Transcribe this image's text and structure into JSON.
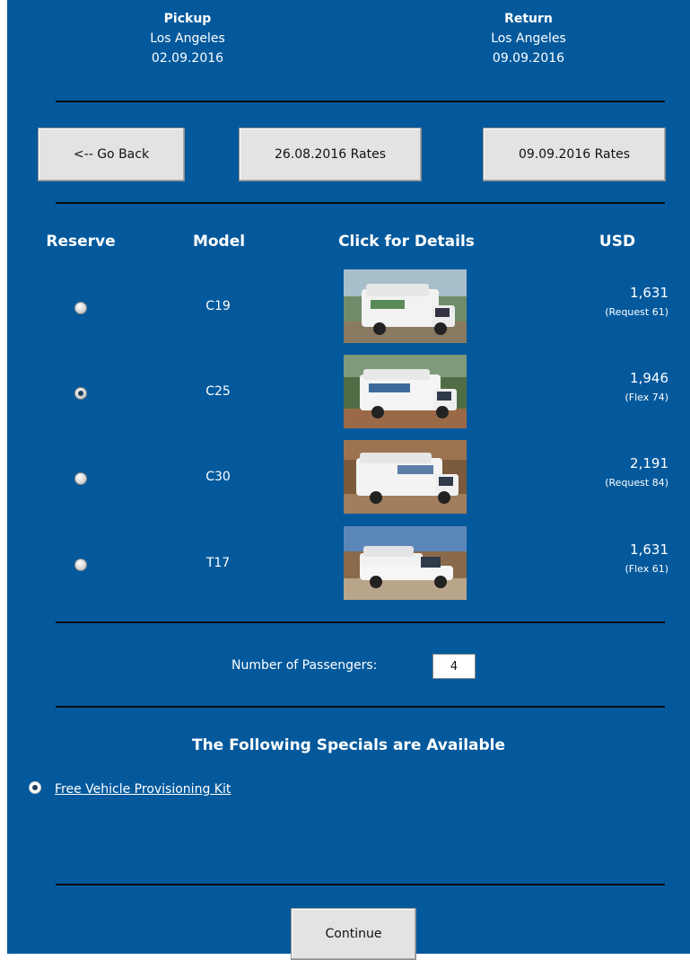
{
  "pickup": {
    "heading": "Pickup",
    "location": "Los Angeles",
    "date": "02.09.2016"
  },
  "return": {
    "heading": "Return",
    "location": "Los Angeles",
    "date": "09.09.2016"
  },
  "nav": {
    "back_label": "<-- Go Back",
    "prev_rates_label": "26.08.2016 Rates",
    "next_rates_label": "09.09.2016 Rates"
  },
  "table": {
    "headers": {
      "reserve": "Reserve",
      "model": "Model",
      "details": "Click for Details",
      "price": "USD"
    },
    "rows": [
      {
        "model": "C19",
        "price": "1,631",
        "note": "(Request 61)",
        "selected": false
      },
      {
        "model": "C25",
        "price": "1,946",
        "note": "(Flex 74)",
        "selected": true
      },
      {
        "model": "C30",
        "price": "2,191",
        "note": "(Request 84)",
        "selected": false
      },
      {
        "model": "T17",
        "price": "1,631",
        "note": "(Flex 61)",
        "selected": false
      }
    ]
  },
  "passengers": {
    "label": "Number of Passengers:",
    "value": "4"
  },
  "specials": {
    "title": "The Following Specials are Available",
    "items": [
      {
        "label": "Free Vehicle Provisioning Kit",
        "selected": true
      }
    ]
  },
  "continue_label": "Continue",
  "colors": {
    "background": "#03599c",
    "rule": "#0b0b0b",
    "button": "#e3e3e3"
  },
  "icons": {
    "vehicle_photo": "rv-photo-icon"
  }
}
